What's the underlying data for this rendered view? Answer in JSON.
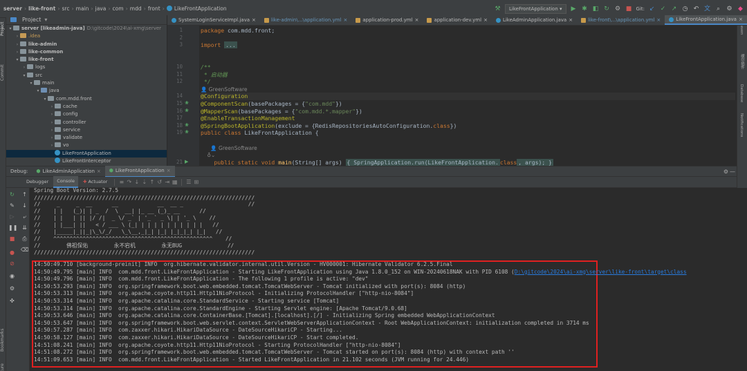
{
  "breadcrumb": [
    "server",
    "like-front",
    "src",
    "main",
    "java",
    "com",
    "mdd",
    "front",
    "LikeFrontApplication"
  ],
  "toolbar": {
    "run_config": "LikeFrontApplication",
    "git_label": "Git:"
  },
  "left_strip": {
    "project": "Project",
    "commit": "Commit",
    "bookmarks": "Bookmarks",
    "structure": "Structure"
  },
  "right_strip": {
    "maven": "Maven",
    "d1": "缓尔插件",
    "db": "Database",
    "notif": "Notifications"
  },
  "project": {
    "title": "Project",
    "tree": [
      {
        "label": "server [likeadmin-java]",
        "path": "D:\\gitcode\\2024\\ai-xmg\\server",
        "depth": 0,
        "arrow": "▾",
        "kind": "module",
        "bold": true
      },
      {
        "label": ".idea",
        "depth": 1,
        "arrow": "›",
        "kind": "folder",
        "color": "orange"
      },
      {
        "label": "like-admin",
        "depth": 1,
        "arrow": "›",
        "kind": "module",
        "bold": true
      },
      {
        "label": "like-common",
        "depth": 1,
        "arrow": "›",
        "kind": "module",
        "bold": true
      },
      {
        "label": "like-front",
        "depth": 1,
        "arrow": "▾",
        "kind": "module",
        "bold": true
      },
      {
        "label": "logs",
        "depth": 2,
        "arrow": "›",
        "kind": "folder"
      },
      {
        "label": "src",
        "depth": 2,
        "arrow": "▾",
        "kind": "folder"
      },
      {
        "label": "main",
        "depth": 3,
        "arrow": "▾",
        "kind": "folder"
      },
      {
        "label": "java",
        "depth": 4,
        "arrow": "▾",
        "kind": "folder",
        "color": "blue"
      },
      {
        "label": "com.mdd.front",
        "depth": 5,
        "arrow": "▾",
        "kind": "folder"
      },
      {
        "label": "cache",
        "depth": 6,
        "arrow": "›",
        "kind": "folder"
      },
      {
        "label": "config",
        "depth": 6,
        "arrow": "›",
        "kind": "folder"
      },
      {
        "label": "controller",
        "depth": 6,
        "arrow": "›",
        "kind": "folder"
      },
      {
        "label": "service",
        "depth": 6,
        "arrow": "›",
        "kind": "folder"
      },
      {
        "label": "validate",
        "depth": 6,
        "arrow": "›",
        "kind": "folder"
      },
      {
        "label": "vo",
        "depth": 6,
        "arrow": "›",
        "kind": "folder"
      },
      {
        "label": "LikeFrontApplication",
        "depth": 6,
        "arrow": "",
        "kind": "class",
        "selected": true
      },
      {
        "label": "LikeFrontInterceptor",
        "depth": 6,
        "arrow": "",
        "kind": "class"
      }
    ]
  },
  "editor_tabs": [
    {
      "label": "SystemLoginServiceImpl.java",
      "icon": "class",
      "style": ""
    },
    {
      "label": "like-admin\\...\\application.yml",
      "icon": "yml",
      "style": "blue"
    },
    {
      "label": "application-prod.yml",
      "icon": "yml",
      "style": ""
    },
    {
      "label": "application-dev.yml",
      "icon": "yml",
      "style": ""
    },
    {
      "label": "LikeAdminApplication.java",
      "icon": "class",
      "style": ""
    },
    {
      "label": "like-front\\...\\application.yml",
      "icon": "yml",
      "style": "blue"
    },
    {
      "label": "LikeFrontApplication.java",
      "icon": "class",
      "style": "active"
    }
  ],
  "editor": {
    "lines": [
      {
        "n": "1",
        "parts": [
          [
            "kw",
            "package "
          ],
          [
            "pl",
            "com.mdd.front;"
          ]
        ]
      },
      {
        "n": "2",
        "parts": []
      },
      {
        "n": "3",
        "parts": [
          [
            "kw",
            "import "
          ],
          [
            "fold-box",
            "..."
          ]
        ]
      },
      {
        "n": "",
        "parts": []
      },
      {
        "n": "",
        "parts": []
      },
      {
        "n": "10",
        "parts": [
          [
            "cmt",
            "/**"
          ]
        ]
      },
      {
        "n": "11",
        "parts": [
          [
            "cmt",
            " * 启动器"
          ]
        ]
      },
      {
        "n": "12",
        "parts": [
          [
            "cmt",
            " */"
          ]
        ]
      },
      {
        "n": "",
        "parts": [
          [
            "author",
            "👤 GreenSoftware"
          ]
        ]
      },
      {
        "n": "14",
        "parts": [
          [
            "ann",
            "@Configuration"
          ]
        ],
        "current": true
      },
      {
        "n": "15",
        "parts": [
          [
            "ann",
            "@ComponentScan"
          ],
          [
            "pl",
            "(basePackages = {"
          ],
          [
            "str",
            "\"com.mdd\""
          ],
          [
            "pl",
            "})"
          ]
        ]
      },
      {
        "n": "16",
        "parts": [
          [
            "ann",
            "@MapperScan"
          ],
          [
            "pl",
            "(basePackages = {"
          ],
          [
            "str",
            "\"com.mdd.*.mapper\""
          ],
          [
            "pl",
            "})"
          ]
        ]
      },
      {
        "n": "17",
        "parts": [
          [
            "ann",
            "@EnableTransactionManagement"
          ]
        ]
      },
      {
        "n": "18",
        "parts": [
          [
            "ann",
            "@SpringBootApplication"
          ],
          [
            "pl",
            "(exclude = {RedisRepositoriesAutoConfiguration."
          ],
          [
            "kw",
            "class"
          ],
          [
            "pl",
            "})"
          ]
        ]
      },
      {
        "n": "19",
        "parts": [
          [
            "kw",
            "public class "
          ],
          [
            "pl",
            "LikeFrontApplication {"
          ]
        ]
      },
      {
        "n": "",
        "parts": []
      },
      {
        "n": "",
        "parts": [
          [
            "author",
            "      👤 GreenSoftware"
          ]
        ]
      },
      {
        "n": "",
        "parts": [
          [
            "author",
            "    ♁⌄"
          ]
        ]
      },
      {
        "n": "21",
        "parts": [
          [
            "kw",
            "    public static void "
          ],
          [
            "fn",
            "main"
          ],
          [
            "pl",
            "(String[] args) "
          ],
          [
            "fold-box",
            "{ SpringApplication.run(LikeFrontApplication."
          ],
          [
            "kw",
            "class"
          ],
          [
            "fold-box",
            ", args); }"
          ]
        ]
      }
    ]
  },
  "debug": {
    "label": "Debug:",
    "sessions": [
      "LikeAdminApplication",
      "LikeFrontApplication"
    ],
    "tabs": [
      "Debugger",
      "Console",
      "Actuator"
    ]
  },
  "console": {
    "banner": [
      "Spring Boot Version: 2.7.5",
      "////////////////////////////////////////////////////////////////////",
      "//     _     _  __      __            __  __ _                    //",
      "//    | |   (_)| | _  /  \\  __| |_ __ (_)_ __      //",
      "//    | |   | || |/ /|  _ \\/ _` | '_ ` _ \\| | '_ \\    //",
      "//    | |___| ||   < / ___ \\ (_| | | | | | | | | | |   //",
      "//    |_____|_||_|\\_\\/_/   \\_\\__,_|_| |_| |_|_|_| |_|   //",
      "//    ^^^^^^^^^^^^^^^^^^^^^^^^^^^^^^^^^^^^^^^^^^^^^^^^^    //",
      "//        佛祖保佑        永不宕机        永无BUG              //",
      "////////////////////////////////////////////////////////////////////"
    ],
    "logs": [
      {
        "t": "14:50:49.710 [background-preinit] INFO  org.hibernate.validator.internal.util.Version - HV000001: Hibernate Validator 6.2.5.Final"
      },
      {
        "t": "14:50:49.795 [main] INFO  com.mdd.front.LikeFrontApplication - Starting LikeFrontApplication using Java 1.8.0_152 on WIN-20240618NAK with PID 6108 (",
        "link": "D:\\gitcode\\2024\\ai-xmg\\server\\like-front\\target\\class"
      },
      {
        "t": "14:50:49.796 [main] INFO  com.mdd.front.LikeFrontApplication - The following 1 profile is active: \"dev\""
      },
      {
        "t": "14:50:53.293 [main] INFO  org.springframework.boot.web.embedded.tomcat.TomcatWebServer - Tomcat initialized with port(s): 8084 (http)"
      },
      {
        "t": "14:50:53.313 [main] INFO  org.apache.coyote.http11.Http11NioProtocol - Initializing ProtocolHandler [\"http-nio-8084\"]"
      },
      {
        "t": "14:50:53.314 [main] INFO  org.apache.catalina.core.StandardService - Starting service [Tomcat]"
      },
      {
        "t": "14:50:53.314 [main] INFO  org.apache.catalina.core.StandardEngine - Starting Servlet engine: [Apache Tomcat/9.0.68]"
      },
      {
        "t": "14:50:53.646 [main] INFO  org.apache.catalina.core.ContainerBase.[Tomcat].[localhost].[/] - Initializing Spring embedded WebApplicationContext"
      },
      {
        "t": "14:50:53.647 [main] INFO  org.springframework.boot.web.servlet.context.ServletWebServerApplicationContext - Root WebApplicationContext: initialization completed in 3714 ms"
      },
      {
        "t": "14:50:57.287 [main] INFO  com.zaxxer.hikari.HikariDataSource - DateSourceHikariCP - Starting..."
      },
      {
        "t": "14:50:58.127 [main] INFO  com.zaxxer.hikari.HikariDataSource - DateSourceHikariCP - Start completed."
      },
      {
        "t": "14:51:08.241 [main] INFO  org.apache.coyote.http11.Http11NioProtocol - Starting ProtocolHandler [\"http-nio-8084\"]"
      },
      {
        "t": "14:51:08.272 [main] INFO  org.springframework.boot.web.embedded.tomcat.TomcatWebServer - Tomcat started on port(s): 8084 (http) with context path ''"
      },
      {
        "t": "14:51:09.653 [main] INFO  com.mdd.front.LikeFrontApplication - Started LikeFrontApplication in 21.102 seconds (JVM running for 24.446)"
      }
    ]
  },
  "colors": {
    "highlight_box": "#e02020",
    "accent": "#4a88c7"
  }
}
